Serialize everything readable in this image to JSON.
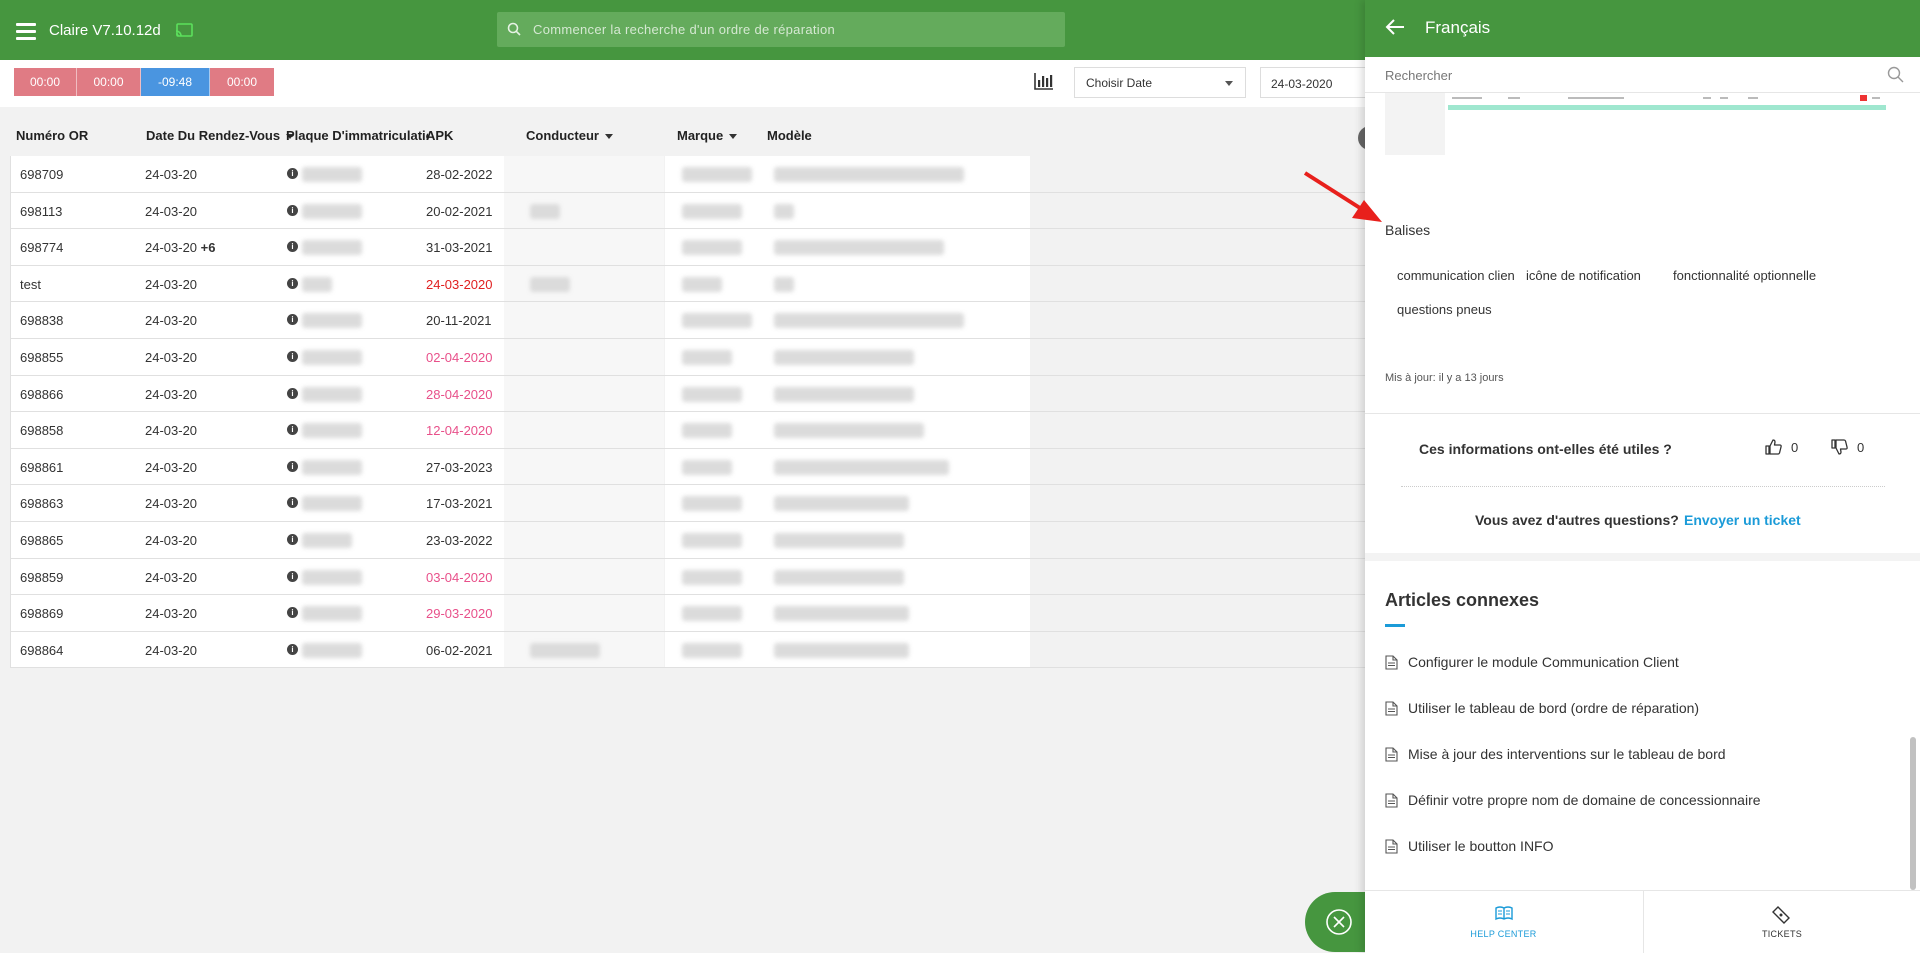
{
  "app": {
    "title": "Claire V7.10.12d",
    "search_placeholder": "Commencer la recherche d'un ordre de réparation",
    "accent_color": "#46963f"
  },
  "toolbar": {
    "timers": [
      {
        "label": "00:00",
        "color": "#e07b84"
      },
      {
        "label": "00:00",
        "color": "#e07b84"
      },
      {
        "label": "-09:48",
        "color": "#4a95e0"
      },
      {
        "label": "00:00",
        "color": "#e07b84"
      }
    ],
    "date_select_value": "Choisir Date",
    "date_value": "24-03-2020",
    "icons": {
      "chart": "bar-chart-icon"
    }
  },
  "table": {
    "columns": [
      "Numéro OR",
      "Date Du Rendez-Vous",
      "Plaque D'immatriculatio",
      "APK",
      "Conducteur",
      "Marque",
      "Modèle"
    ],
    "rows": [
      {
        "or": "698709",
        "date": "24-03-20",
        "extra": "",
        "apk": "28-02-2022",
        "apk_color": "normal"
      },
      {
        "or": "698113",
        "date": "24-03-20",
        "extra": "",
        "apk": "20-02-2021",
        "apk_color": "normal"
      },
      {
        "or": "698774",
        "date": "24-03-20",
        "extra": "+6",
        "apk": "31-03-2021",
        "apk_color": "normal"
      },
      {
        "or": "test",
        "date": "24-03-20",
        "extra": "",
        "apk": "24-03-2020",
        "apk_color": "red"
      },
      {
        "or": "698838",
        "date": "24-03-20",
        "extra": "",
        "apk": "20-11-2021",
        "apk_color": "normal"
      },
      {
        "or": "698855",
        "date": "24-03-20",
        "extra": "",
        "apk": "02-04-2020",
        "apk_color": "pink"
      },
      {
        "or": "698866",
        "date": "24-03-20",
        "extra": "",
        "apk": "28-04-2020",
        "apk_color": "pink"
      },
      {
        "or": "698858",
        "date": "24-03-20",
        "extra": "",
        "apk": "12-04-2020",
        "apk_color": "pink"
      },
      {
        "or": "698861",
        "date": "24-03-20",
        "extra": "",
        "apk": "27-03-2023",
        "apk_color": "normal"
      },
      {
        "or": "698863",
        "date": "24-03-20",
        "extra": "",
        "apk": "17-03-2021",
        "apk_color": "normal"
      },
      {
        "or": "698865",
        "date": "24-03-20",
        "extra": "",
        "apk": "23-03-2022",
        "apk_color": "normal"
      },
      {
        "or": "698859",
        "date": "24-03-20",
        "extra": "",
        "apk": "03-04-2020",
        "apk_color": "pink"
      },
      {
        "or": "698869",
        "date": "24-03-20",
        "extra": "",
        "apk": "29-03-2020",
        "apk_color": "pink"
      },
      {
        "or": "698864",
        "date": "24-03-20",
        "extra": "",
        "apk": "06-02-2021",
        "apk_color": "normal"
      }
    ]
  },
  "panel": {
    "header_title": "Français",
    "search_placeholder": "Rechercher",
    "tags_title": "Balises",
    "tags": [
      "communication client",
      "icône de notification",
      "fonctionnalité optionnelle",
      "questions pneus"
    ],
    "updated": "Mis à jour: il y a 13 jours",
    "feedback_question": "Ces informations ont-elles été utiles ?",
    "likes": "0",
    "dislikes": "0",
    "other_questions": "Vous avez d'autres questions?",
    "ticket_link": "Envoyer un ticket",
    "related_title": "Articles connexes",
    "related": [
      "Configurer le module Communication Client",
      "Utiliser le tableau de bord (ordre de réparation)",
      "Mise à jour des interventions sur le tableau de bord",
      "Définir votre propre nom de domaine de concessionnaire",
      "Utiliser le boutton INFO"
    ],
    "footer": {
      "help_center": "HELP CENTER",
      "tickets": "TICKETS"
    },
    "link_color": "#1b9bd8"
  }
}
